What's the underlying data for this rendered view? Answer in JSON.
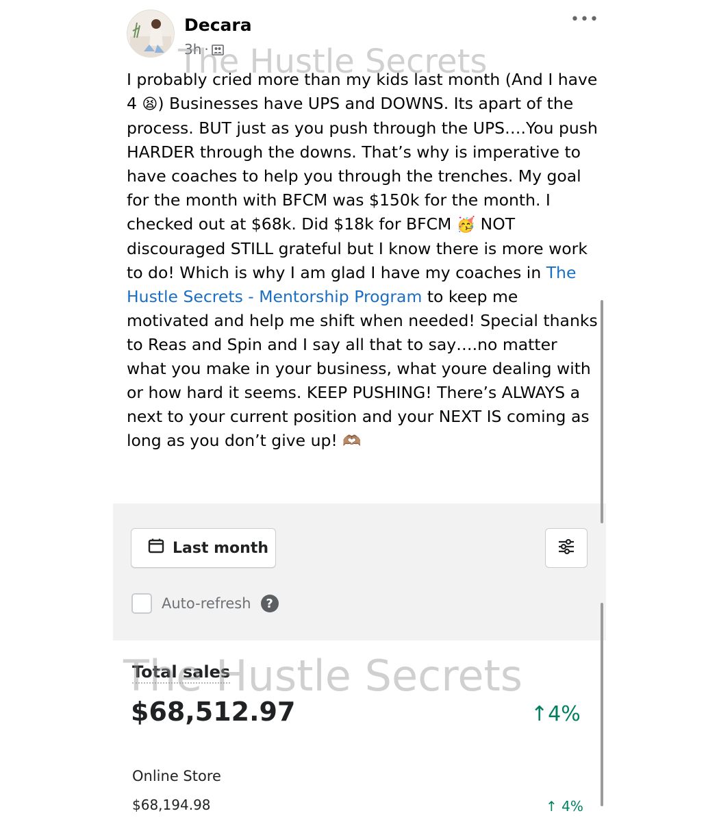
{
  "post": {
    "author": "Decara",
    "timestamp": "3h",
    "separator": "·",
    "audience_icon": "group-icon",
    "more_icon": "ellipsis-icon",
    "watermark": "The Hustle Secrets",
    "text_p1_before_emoji": "I probably cried more than my kids last month (And I have 4 ",
    "emoji_tired": "😫",
    "text_p1_mid": ") Businesses have UPS and DOWNS.  Its apart of the process.  BUT just as you push through the UPS….You push HARDER through the downs.  That’s why is imperative to have coaches to help you through the trenches.  My goal for the month with BFCM was $150k for the month.  I checked out at $68k. Did $18k for BFCM ",
    "emoji_party": "🥳",
    "text_p1_after_party": " NOT discouraged STILL grateful but I know there is more work to do!  Which is why I am glad I have my coaches in ",
    "link_text": "The Hustle Secrets - Mentorship Program",
    "text_p1_end": " to keep me motivated and help me shift when needed!  Special thanks to Reas and Spin and I say all that to say….no matter what you make in your business, what youre dealing with or how hard it seems.  KEEP PUSHING!  There’s ALWAYS a next to your current position and your NEXT IS coming as long as you don’t give up!  ",
    "emoji_heart_hands": "🫶🏽"
  },
  "embed": {
    "date_button_label": "Last month",
    "calendar_icon": "calendar-icon",
    "filter_icon": "sliders-icon",
    "auto_refresh_label": "Auto-refresh",
    "help_icon": "?",
    "watermark": "The Hustle Secrets",
    "total_sales_label": "Total sales",
    "total_sales_value": "$68,512.97",
    "total_sales_change": "↑4%",
    "online_store_label": "Online Store",
    "online_store_value": "$68,194.98",
    "online_store_change": "↑ 4%",
    "change_color": "#008060",
    "link_color": "#1b6ec2"
  }
}
